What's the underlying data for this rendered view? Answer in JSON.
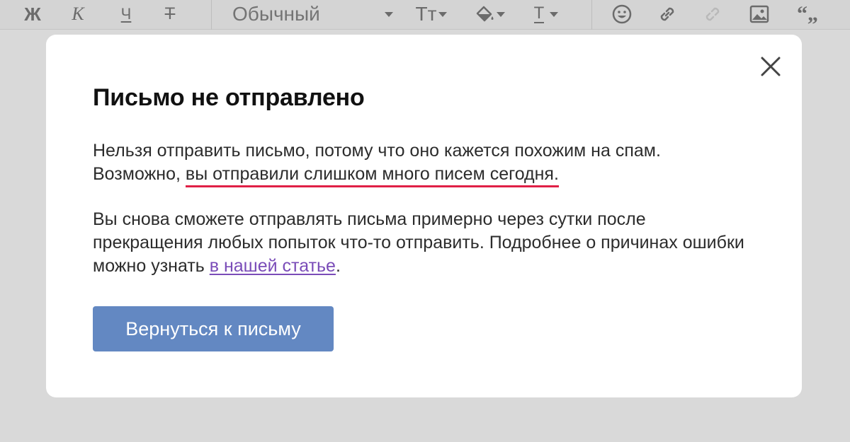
{
  "toolbar": {
    "bold_label": "Ж",
    "italic_label": "К",
    "underline_label": "Ч",
    "strike_label": "Т",
    "format_value": "Обычный",
    "font_size_label": "Тт",
    "text_color_label": "Т",
    "quote_label": "“„",
    "icons": [
      "bold-icon",
      "italic-icon",
      "underline-icon",
      "strikethrough-icon",
      "font-size-icon",
      "fill-color-icon",
      "text-color-icon",
      "emoji-icon",
      "link-icon",
      "unlink-icon",
      "image-icon",
      "quote-icon"
    ]
  },
  "modal": {
    "title": "Письмо не отправлено",
    "para1_start": "Нельзя отправить письмо, потому что оно кажется похожим на спам. Возможно,",
    "para1_underlined": "вы отправили слишком много писем сегодня.",
    "para2_start": "Вы снова сможете отправлять письма примерно через сутки после прекращения любых попыток что-то отправить. Подробнее о причинах ошибки можно узнать",
    "para2_link": "в нашей статье",
    "para2_end": ".",
    "button_label": "Вернуться к письму"
  },
  "colors": {
    "background": "#d9d9d9",
    "button": "#6388c2",
    "link": "#7a4cb8",
    "underline_accent": "#e02046"
  }
}
